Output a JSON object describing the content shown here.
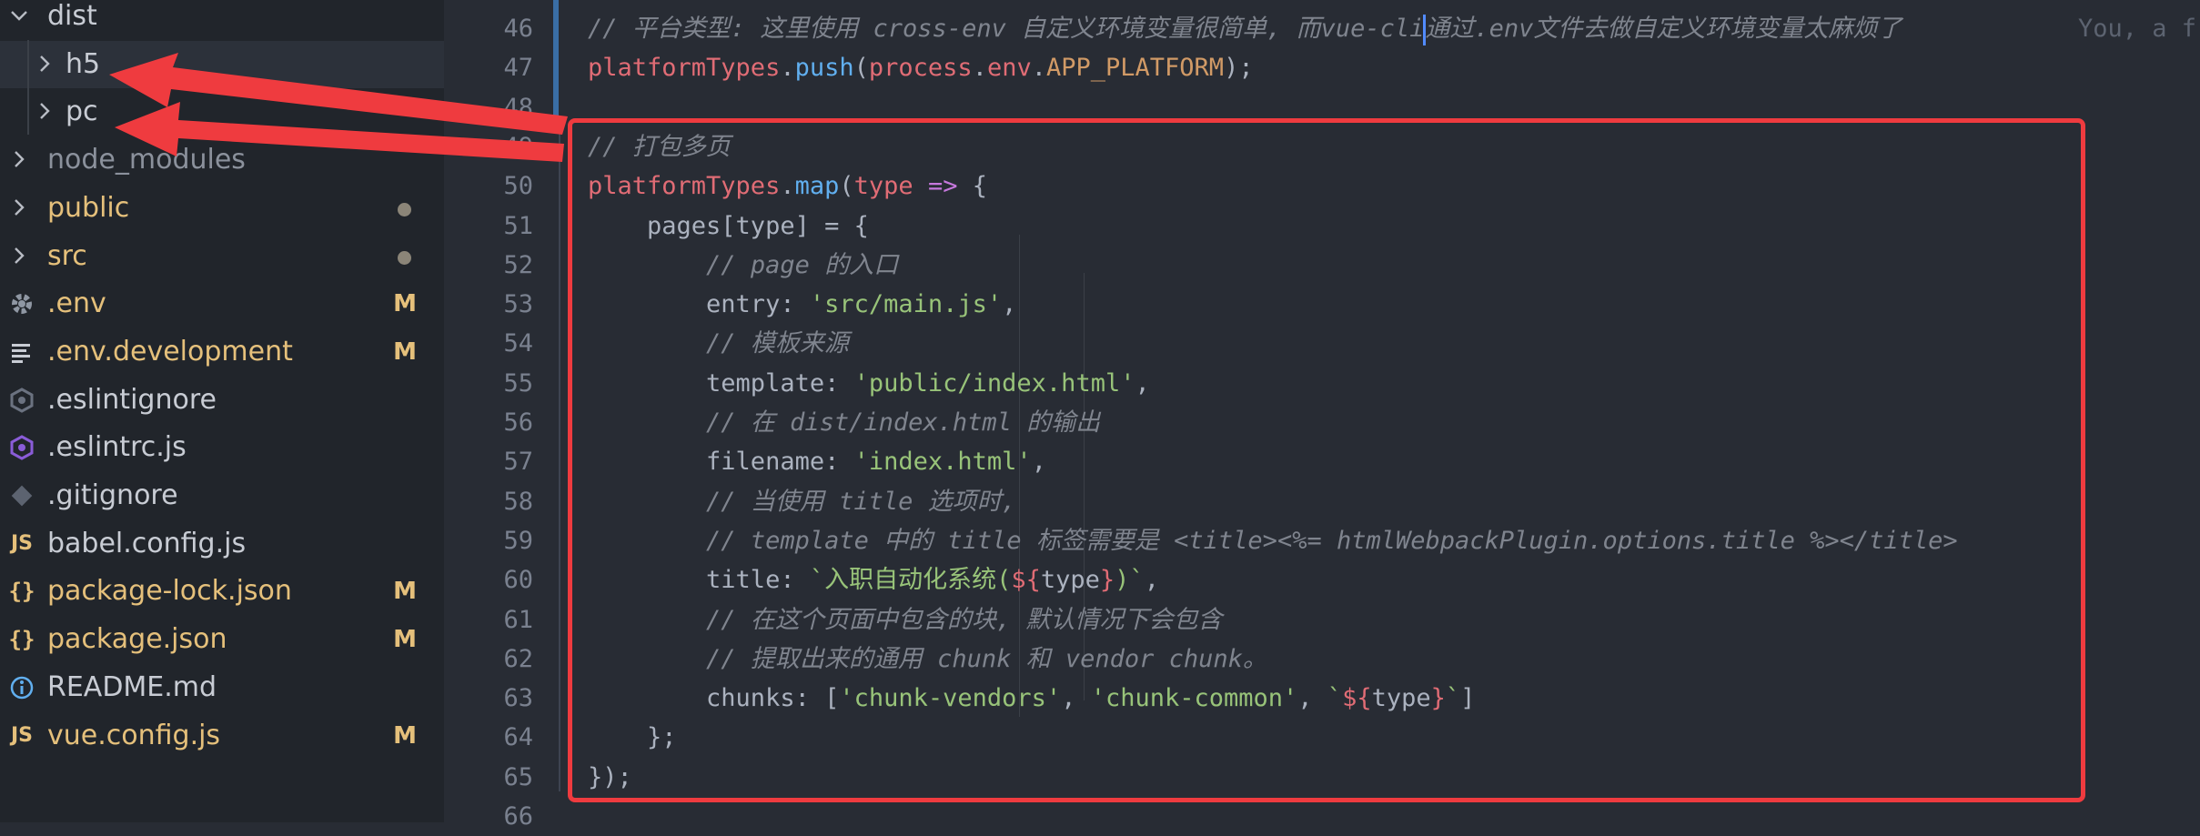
{
  "explorer": {
    "items": [
      {
        "label": "dist",
        "chevron": "open",
        "icon": "",
        "badge": "",
        "dot": false,
        "color": "#c8ccd4"
      },
      {
        "label": "h5",
        "chevron": "closed",
        "icon": "",
        "badge": "",
        "dot": false,
        "color": "#c8ccd4"
      },
      {
        "label": "pc",
        "chevron": "closed",
        "icon": "",
        "badge": "",
        "dot": false,
        "color": "#c8ccd4"
      },
      {
        "label": "node_modules",
        "chevron": "closed",
        "icon": "",
        "badge": "",
        "dot": false,
        "color": "#8b919c"
      },
      {
        "label": "public",
        "chevron": "closed",
        "icon": "",
        "badge": "",
        "dot": true,
        "color": "#e5c07b"
      },
      {
        "label": "src",
        "chevron": "closed",
        "icon": "",
        "badge": "",
        "dot": true,
        "color": "#e5c07b"
      },
      {
        "label": ".env",
        "chevron": "",
        "icon": "gear-icon",
        "badge": "M",
        "dot": false,
        "color": "#e5c07b"
      },
      {
        "label": ".env.development",
        "chevron": "",
        "icon": "lines-icon",
        "badge": "M",
        "dot": false,
        "color": "#e5c07b"
      },
      {
        "label": ".eslintignore",
        "chevron": "",
        "icon": "eslint-icon",
        "badge": "",
        "dot": false,
        "color": "#c8ccd4"
      },
      {
        "label": ".eslintrc.js",
        "chevron": "",
        "icon": "eslint-purple-icon",
        "badge": "",
        "dot": false,
        "color": "#c8ccd4"
      },
      {
        "label": ".gitignore",
        "chevron": "",
        "icon": "git-icon",
        "badge": "",
        "dot": false,
        "color": "#c8ccd4"
      },
      {
        "label": "babel.config.js",
        "chevron": "",
        "icon": "js-icon",
        "badge": "",
        "dot": false,
        "color": "#c8ccd4"
      },
      {
        "label": "package-lock.json",
        "chevron": "",
        "icon": "json-icon",
        "badge": "M",
        "dot": false,
        "color": "#e5c07b"
      },
      {
        "label": "package.json",
        "chevron": "",
        "icon": "json-icon",
        "badge": "M",
        "dot": false,
        "color": "#e5c07b"
      },
      {
        "label": "README.md",
        "chevron": "",
        "icon": "info-icon",
        "badge": "",
        "dot": false,
        "color": "#c8ccd4"
      },
      {
        "label": "vue.config.js",
        "chevron": "",
        "icon": "js-icon",
        "badge": "M",
        "dot": false,
        "color": "#e5c07b"
      }
    ]
  },
  "editor": {
    "blame_text": "You, a f",
    "lines": [
      {
        "n": "46",
        "tokens": [
          [
            "cm",
            "// 平台类型: 这里使用 cross-env 自定义环境变量很简单, 而vue-cli"
          ],
          [
            "cursor",
            ""
          ],
          [
            "cm",
            "通过.env文件去做自定义环境变量太麻烦了"
          ]
        ]
      },
      {
        "n": "47",
        "tokens": [
          [
            "ob",
            "platformTypes"
          ],
          [
            "pl",
            "."
          ],
          [
            "fn",
            "push"
          ],
          [
            "pl",
            "("
          ],
          [
            "ob",
            "process"
          ],
          [
            "pl",
            "."
          ],
          [
            "ob",
            "env"
          ],
          [
            "pl",
            "."
          ],
          [
            "pr",
            "APP_PLATFORM"
          ],
          [
            "pl",
            ");"
          ]
        ]
      },
      {
        "n": "48",
        "tokens": []
      },
      {
        "n": "49",
        "tokens": [
          [
            "cm",
            "// 打包多页"
          ]
        ]
      },
      {
        "n": "50",
        "tokens": [
          [
            "ob",
            "platformTypes"
          ],
          [
            "pl",
            "."
          ],
          [
            "fn",
            "map"
          ],
          [
            "pl",
            "("
          ],
          [
            "ob",
            "type"
          ],
          [
            "pl",
            " "
          ],
          [
            "kw",
            "=>"
          ],
          [
            "pl",
            " {"
          ]
        ]
      },
      {
        "n": "51",
        "tokens": [
          [
            "pl",
            "    pages[type] = {"
          ]
        ]
      },
      {
        "n": "52",
        "tokens": [
          [
            "pl",
            "        "
          ],
          [
            "cm",
            "// page 的入口"
          ]
        ]
      },
      {
        "n": "53",
        "tokens": [
          [
            "pl",
            "        entry: "
          ],
          [
            "st",
            "'src/main.js'"
          ],
          [
            "pl",
            ","
          ]
        ]
      },
      {
        "n": "54",
        "tokens": [
          [
            "pl",
            "        "
          ],
          [
            "cm",
            "// 模板来源"
          ]
        ]
      },
      {
        "n": "55",
        "tokens": [
          [
            "pl",
            "        template: "
          ],
          [
            "st",
            "'public/index.html'"
          ],
          [
            "pl",
            ","
          ]
        ]
      },
      {
        "n": "56",
        "tokens": [
          [
            "pl",
            "        "
          ],
          [
            "cm",
            "// 在 dist/index.html 的输出"
          ]
        ]
      },
      {
        "n": "57",
        "tokens": [
          [
            "pl",
            "        filename: "
          ],
          [
            "st",
            "'index.html'"
          ],
          [
            "pl",
            ","
          ]
        ]
      },
      {
        "n": "58",
        "tokens": [
          [
            "pl",
            "        "
          ],
          [
            "cm",
            "// 当使用 title 选项时,"
          ]
        ]
      },
      {
        "n": "59",
        "tokens": [
          [
            "pl",
            "        "
          ],
          [
            "cm",
            "// template 中的 title 标签需要是 <title><%= htmlWebpackPlugin.options.title %></title>"
          ]
        ]
      },
      {
        "n": "60",
        "tokens": [
          [
            "pl",
            "        title: "
          ],
          [
            "st",
            "`入职自动化系统("
          ],
          [
            "ob",
            "${"
          ],
          [
            "pl",
            "type"
          ],
          [
            "ob",
            "}"
          ],
          [
            "st",
            ")`"
          ],
          [
            "pl",
            ","
          ]
        ]
      },
      {
        "n": "61",
        "tokens": [
          [
            "pl",
            "        "
          ],
          [
            "cm",
            "// 在这个页面中包含的块, 默认情况下会包含"
          ]
        ]
      },
      {
        "n": "62",
        "tokens": [
          [
            "pl",
            "        "
          ],
          [
            "cm",
            "// 提取出来的通用 chunk 和 vendor chunk。"
          ]
        ]
      },
      {
        "n": "63",
        "tokens": [
          [
            "pl",
            "        chunks: ["
          ],
          [
            "st",
            "'chunk-vendors'"
          ],
          [
            "pl",
            ", "
          ],
          [
            "st",
            "'chunk-common'"
          ],
          [
            "pl",
            ", "
          ],
          [
            "st",
            "`"
          ],
          [
            "ob",
            "${"
          ],
          [
            "pl",
            "type"
          ],
          [
            "ob",
            "}"
          ],
          [
            "st",
            "`"
          ],
          [
            "pl",
            "]"
          ]
        ]
      },
      {
        "n": "64",
        "tokens": [
          [
            "pl",
            "    };"
          ]
        ]
      },
      {
        "n": "65",
        "tokens": [
          [
            "pl",
            "});"
          ]
        ]
      },
      {
        "n": "66",
        "tokens": []
      }
    ]
  },
  "annotation": {
    "color": "#ef3b3f"
  }
}
